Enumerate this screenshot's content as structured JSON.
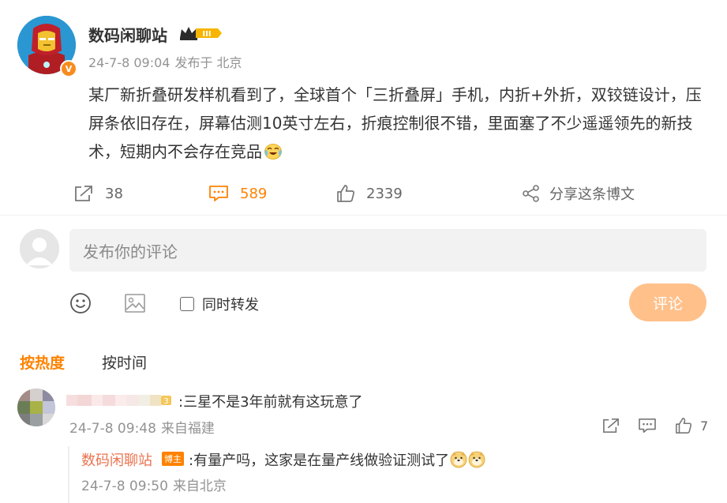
{
  "post": {
    "username": "数码闲聊站",
    "level_badge": "III",
    "verified_badge": "V",
    "date": "24-7-8 09:04",
    "source": "发布于 北京",
    "content": "某厂新折叠研发样机看到了，全球首个「三折叠屏」手机，内折+外折，双铰链设计，压屏条依旧存在，屏幕估测10英寸左右，折痕控制很不错，里面塞了不少遥遥领先的新技术，短期内不会存在竞品"
  },
  "actions": {
    "repost_count": "38",
    "comment_count": "589",
    "like_count": "2339",
    "share_label": "分享这条博文"
  },
  "composer": {
    "placeholder": "发布你的评论",
    "repost_label": "同时转发",
    "submit_label": "评论"
  },
  "sort": {
    "hot_label": "按热度",
    "time_label": "按时间"
  },
  "comments": [
    {
      "text": ":三星不是3年前就有这玩意了",
      "date": "24-7-8 09:48",
      "source": "来自福建",
      "like_count": "7",
      "fan_level": "3",
      "replies": [
        {
          "username": "数码闲聊站",
          "badge": "博主",
          "text": ":有量产吗，这家是在量产线做验证测试了",
          "date": "24-7-8 09:50",
          "source": "来自北京"
        }
      ]
    }
  ],
  "colors": {
    "accent": "#ff8200",
    "reply_name": "#eb7350",
    "muted": "#939393",
    "submit_disabled": "#ffc08a"
  },
  "icons": [
    "ironman-avatar",
    "crown-badge-icon",
    "repost-icon",
    "comment-icon",
    "like-icon",
    "share-icon",
    "emoji-icon",
    "image-icon",
    "laugh-cry-emoji",
    "doge-emoji"
  ]
}
